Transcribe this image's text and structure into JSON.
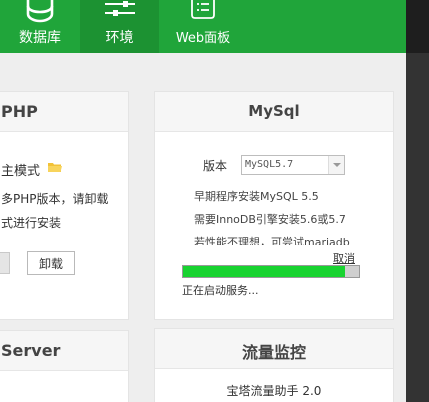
{
  "nav": {
    "items": [
      {
        "label": "数据库",
        "icon": "database-icon"
      },
      {
        "label": "环境",
        "icon": "sliders-icon"
      },
      {
        "label": "Web面板",
        "icon": "web-panel-icon"
      }
    ],
    "active": 1
  },
  "php_panel": {
    "title": "PHP",
    "mode_label": "主模式",
    "desc_line1": "多PHP版本，请卸载",
    "desc_line2": "式进行安装",
    "uninstall_label": "卸载"
  },
  "mysql_panel": {
    "title": "MySql",
    "version_label": "版本",
    "version_value": "MySQL5.7",
    "notes": [
      "早期程序安装MySQL 5.5",
      "需要InnoDB引擎安装5.6或5.7",
      "若性能不理想，可尝试mariadb"
    ],
    "cancel_label": "取消",
    "progress": 0.92,
    "status": "正在启动服务..."
  },
  "server_panel": {
    "title": "Server"
  },
  "flow_panel": {
    "title": "流量监控",
    "item": "宝塔流量助手 2.0"
  },
  "colors": {
    "brand": "#20a53a",
    "progress": "#18d330"
  }
}
